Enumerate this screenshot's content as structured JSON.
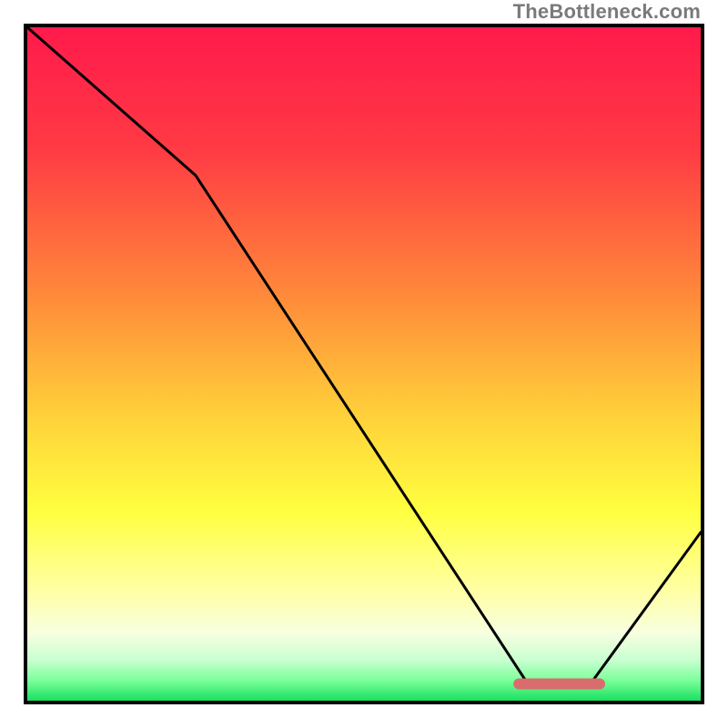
{
  "watermark": "TheBottleneck.com",
  "chart_data": {
    "type": "line",
    "title": "",
    "xlabel": "",
    "ylabel": "",
    "xlim": [
      0,
      100
    ],
    "ylim": [
      0,
      100
    ],
    "gradient_stops": [
      {
        "offset": 0,
        "color": "#ff1a4b"
      },
      {
        "offset": 18,
        "color": "#ff3a44"
      },
      {
        "offset": 40,
        "color": "#ff8a3a"
      },
      {
        "offset": 58,
        "color": "#ffd23a"
      },
      {
        "offset": 72,
        "color": "#ffff40"
      },
      {
        "offset": 84,
        "color": "#ffffa8"
      },
      {
        "offset": 90,
        "color": "#f7ffe0"
      },
      {
        "offset": 94,
        "color": "#c8ffd0"
      },
      {
        "offset": 97,
        "color": "#7bff9a"
      },
      {
        "offset": 100,
        "color": "#18e060"
      }
    ],
    "series": [
      {
        "name": "bottleneck-curve",
        "x": [
          0,
          25,
          74,
          84,
          100
        ],
        "y": [
          100,
          78,
          3,
          3,
          25
        ],
        "stroke": "#000000",
        "width": 3
      }
    ],
    "marker": {
      "name": "optimal-range",
      "x_start": 73,
      "x_end": 85,
      "y": 2.5,
      "color": "#d96c6c",
      "thickness": 12,
      "rounded": true
    }
  }
}
